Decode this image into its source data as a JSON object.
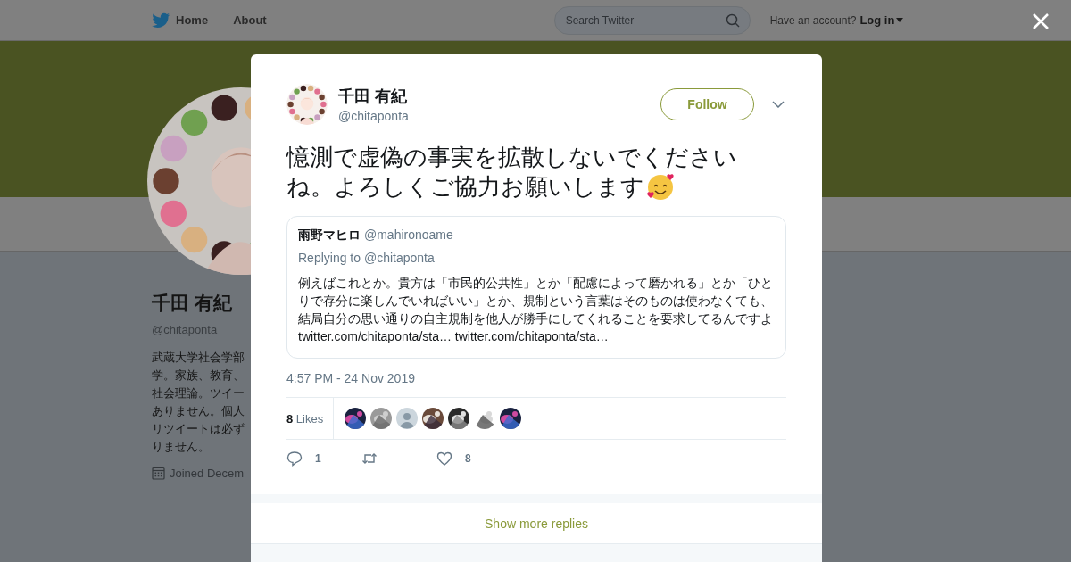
{
  "nav": {
    "items": [
      {
        "label": "Home"
      },
      {
        "label": "About"
      }
    ],
    "search": {
      "placeholder": "Search Twitter"
    },
    "account_prompt": "Have an account?",
    "login": "Log in"
  },
  "profile": {
    "name": "千田 有紀",
    "handle": "@chitaponta",
    "bio_lines": [
      "武蔵大学社会学部",
      "学。家族、教育、",
      "社会理論。ツイー",
      "ありません。個人",
      "リツイートは必ず",
      "りません。"
    ],
    "joined": "Joined Decem"
  },
  "tweet": {
    "name": "千田 有紀",
    "handle": "@chitaponta",
    "follow": "Follow",
    "text_lines": [
      "憶測で虚偽の事実を拡散しないでください",
      "ね。よろしくご協力お願いします"
    ],
    "quote": {
      "name": "雨野マヒロ",
      "handle": "@mahironoame",
      "replying": "Replying to @chitaponta",
      "text": "例えばこれとか。貴方は「市民的公共性」とか「配慮によって磨かれる」とか「ひとりで存分に楽しんでいればいい」とか、規制という言葉はそのものは使わなくても、結局自分の思い通りの自主規制を他人が勝手にしてくれることを要求してるんですよ",
      "links": [
        "twitter.com/chitaponta/sta…",
        "twitter.com/chitaponta/sta…"
      ]
    },
    "time": "4:57 PM - 24 Nov 2019",
    "likes": "**8** Likes",
    "likers": [
      {
        "kind": "picture"
      },
      {
        "kind": "picture"
      },
      {
        "kind": "default"
      },
      {
        "kind": "picture"
      },
      {
        "kind": "picture"
      },
      {
        "kind": "picture"
      },
      {
        "kind": "picture"
      }
    ],
    "actions": [
      {
        "kind": "reply",
        "count": "1"
      },
      {
        "kind": "retweet"
      },
      {
        "kind": "like",
        "count": "8"
      }
    ]
  },
  "show_more": "Show more replies"
}
